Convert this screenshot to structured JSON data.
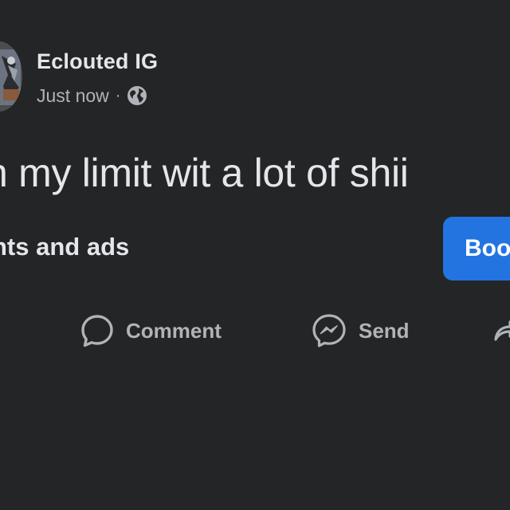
{
  "post": {
    "author": "Eclouted IG",
    "timestamp": "Just now",
    "separator": "·",
    "privacy_icon": "globe-icon",
    "text": "n my limit wit a lot of shii"
  },
  "promo": {
    "text": "hts and ads",
    "button_label": "Boo"
  },
  "actions": {
    "comment_label": "Comment",
    "send_label": "Send"
  },
  "colors": {
    "background": "#242526",
    "primary_text": "#e4e6eb",
    "secondary_text": "#b0b3b8",
    "accent": "#2374e1"
  }
}
